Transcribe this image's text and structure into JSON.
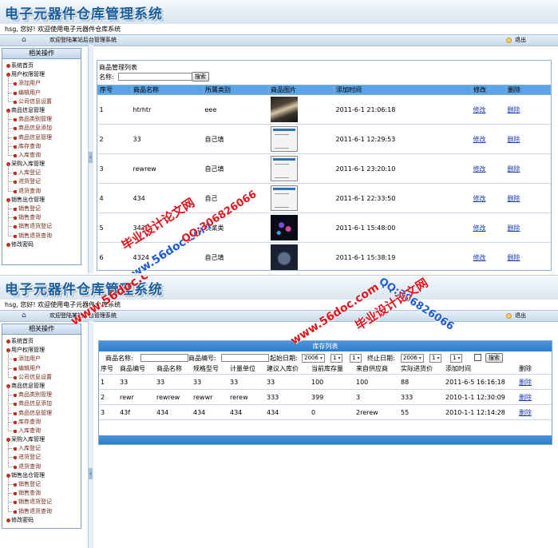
{
  "app": {
    "title": "电子元器件仓库管理系统",
    "welcome": "hsg, 您好! 欢迎使用电子元器件仓库系统",
    "nav_message": "欢迎登陆某站后台管理系统",
    "logout": "退出",
    "home_icon": "home-icon"
  },
  "sidebar": {
    "header": "相关操作",
    "items": [
      {
        "label": "系统首页",
        "type": "group"
      },
      {
        "label": "用户权限管理",
        "type": "group"
      },
      {
        "label": "添加用户",
        "type": "sub"
      },
      {
        "label": "编辑用户",
        "type": "sub"
      },
      {
        "label": "公司信息设置",
        "type": "sub"
      },
      {
        "label": "商品信息管理",
        "type": "group"
      },
      {
        "label": "商品类别管理",
        "type": "sub"
      },
      {
        "label": "商品信息添加",
        "type": "sub"
      },
      {
        "label": "商品信息管理",
        "type": "sub"
      },
      {
        "label": "库存查询",
        "type": "sub"
      },
      {
        "label": "入库查询",
        "type": "sub"
      },
      {
        "label": "采购入库管理",
        "type": "group"
      },
      {
        "label": "入库登记",
        "type": "sub"
      },
      {
        "label": "进货登记",
        "type": "sub"
      },
      {
        "label": "退货查询",
        "type": "sub"
      },
      {
        "label": "销售出仓管理",
        "type": "group"
      },
      {
        "label": "销售登记",
        "type": "sub"
      },
      {
        "label": "销售查询",
        "type": "sub"
      },
      {
        "label": "销售退货登记",
        "type": "sub"
      },
      {
        "label": "销售退货查询",
        "type": "sub"
      },
      {
        "label": "修改密码",
        "type": "group"
      }
    ]
  },
  "product_list": {
    "caption": "商品管理列表",
    "search_label": "名称:",
    "search_value": "",
    "search_button": "搜索",
    "columns": [
      "序号",
      "商品名称",
      "所属类别",
      "商品图片",
      "添加时间",
      "修改",
      "删除"
    ],
    "rows": [
      {
        "no": "1",
        "name": "htrhtr",
        "category": "eee",
        "image": "person-photo",
        "time": "2011-6-1 21:06:18",
        "edit": "修改",
        "delete": "删除"
      },
      {
        "no": "2",
        "name": "33",
        "category": "自己填",
        "image": "screenshot-thumb",
        "time": "2011-6-1 12:29:53",
        "edit": "修改",
        "delete": "删除"
      },
      {
        "no": "3",
        "name": "rewrew",
        "category": "自己填",
        "image": "screenshot-thumb",
        "time": "2011-6-1 23:20:10",
        "edit": "修改",
        "delete": "删除"
      },
      {
        "no": "4",
        "name": "434",
        "category": "自己",
        "image": "screenshot-thumb",
        "time": "2011-6-1 22:33:50",
        "edit": "修改",
        "delete": "删除"
      },
      {
        "no": "5",
        "name": "3434",
        "category": "某某类",
        "image": "night-photo",
        "time": "2011-6-1 15:48:00",
        "edit": "修改",
        "delete": "删除"
      },
      {
        "no": "6",
        "name": "4324",
        "category": "自己填",
        "image": "device-photo",
        "time": "2011-6-1 15:38:19",
        "edit": "修改",
        "delete": "删除"
      }
    ]
  },
  "stock_list": {
    "caption": "库存列表",
    "filters": {
      "name_label": "商品名称:",
      "code_label": "商品编号:",
      "start_label": "起始日期:",
      "end_label": "终止日期:",
      "start_year": "2006",
      "start_month": "1",
      "start_day": "1",
      "end_year": "2006",
      "end_month": "1",
      "end_day": "1",
      "search_button": "搜索"
    },
    "columns": [
      "序号",
      "商品编号",
      "商品名称",
      "规格型号",
      "计量单位",
      "建议入库价",
      "当前库存量",
      "来自供应商",
      "实际进货价",
      "添加时间",
      "删除"
    ],
    "rows": [
      {
        "no": "1",
        "code": "33",
        "name": "33",
        "spec": "33",
        "unit": "33",
        "price": "33",
        "stock": "100",
        "supplier": "100",
        "actual": "88",
        "time": "2011-6-5 16:16:18",
        "delete": "删除"
      },
      {
        "no": "2",
        "code": "rewr",
        "name": "rewrew",
        "spec": "rewwr",
        "unit": "rerew",
        "price": "333",
        "stock": "399",
        "supplier": "3",
        "actual": "333",
        "time": "2010-1-1 12:30:09",
        "delete": "删除"
      },
      {
        "no": "3",
        "code": "43f",
        "name": "434",
        "spec": "434",
        "unit": "434",
        "price": "434",
        "stock": "0",
        "supplier": "2rerew",
        "actual": "55",
        "time": "2010-1-1 12:14:28",
        "delete": "删除"
      }
    ]
  },
  "watermarks": {
    "site": "www.56doc.com",
    "qq": "QQ:306826066",
    "name": "毕业设计论文网"
  }
}
